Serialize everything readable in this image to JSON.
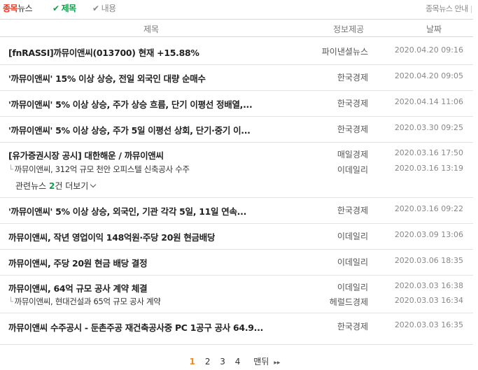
{
  "brand": {
    "part1": "종목",
    "part2": "뉴스"
  },
  "filters": {
    "title": "제목",
    "content": "내용"
  },
  "guide": {
    "label": "종목뉴스 안내",
    "sep": "|"
  },
  "columns": {
    "title": "제목",
    "source": "정보제공",
    "date": "날짜"
  },
  "rows": [
    {
      "title": "[fnRASSI]까뮤이앤씨(013700) 현재 +15.88%",
      "source": "파이낸셜뉴스",
      "date": "2020.04.20 09:16"
    },
    {
      "title": "'까뮤이앤씨' 15% 이상 상승, 전일 외국인 대량 순매수",
      "source": "한국경제",
      "date": "2020.04.20 09:05"
    },
    {
      "title": "'까뮤이앤씨' 5% 이상 상승, 주가 상승 흐름, 단기 이평선 정배열,...",
      "source": "한국경제",
      "date": "2020.04.14 11:06"
    },
    {
      "title": "'까뮤이앤씨' 5% 이상 상승, 주가 5일 이평선 상회, 단기·중기 이...",
      "source": "한국경제",
      "date": "2020.03.30 09:25"
    },
    {
      "title": "[유가증권시장 공시] 대한해운 / 까뮤이앤씨",
      "source": "매일경제",
      "date": "2020.03.16 17:50",
      "sub": {
        "title": "까뮤이앤씨, 312억 규모 천안 오피스텔 신축공사 수주",
        "source": "이데일리",
        "date": "2020.03.16 13:19"
      },
      "more": {
        "prefix": "관련뉴스 ",
        "count": "2",
        "suffix": "건 더보기"
      }
    },
    {
      "title": "'까뮤이앤씨' 5% 이상 상승, 외국인, 기관 각각 5일, 11일 연속...",
      "source": "한국경제",
      "date": "2020.03.16 09:22"
    },
    {
      "title": "까뮤이앤씨, 작년 영업이익 148억원·주당 20원 현금배당",
      "source": "이데일리",
      "date": "2020.03.09 13:06"
    },
    {
      "title": "까뮤이앤씨, 주당 20원 현금 배당 결정",
      "source": "이데일리",
      "date": "2020.03.06 18:35"
    },
    {
      "title": "까뮤이앤씨, 64억 규모 공사 계약 체결",
      "source": "이데일리",
      "date": "2020.03.03 16:38",
      "sub": {
        "title": "까뮤이앤씨, 현대건설과 65억 규모 공사 계약",
        "source": "헤럴드경제",
        "date": "2020.03.03 16:34"
      }
    },
    {
      "title": "까뮤이앤씨 수주공시 - 둔촌주공 재건축공사중 PC 1공구 공사 64.9...",
      "source": "한국경제",
      "date": "2020.03.03 16:35"
    }
  ],
  "pagination": {
    "pages": [
      "1",
      "2",
      "3",
      "4"
    ],
    "current": "1",
    "last": "맨뒤",
    "next_icon": "▸▸"
  },
  "icons": {
    "check": "✔"
  },
  "colors": {
    "brand_red": "#e8341c",
    "active_green": "#0f9d4a",
    "current_page": "#f08a24"
  }
}
